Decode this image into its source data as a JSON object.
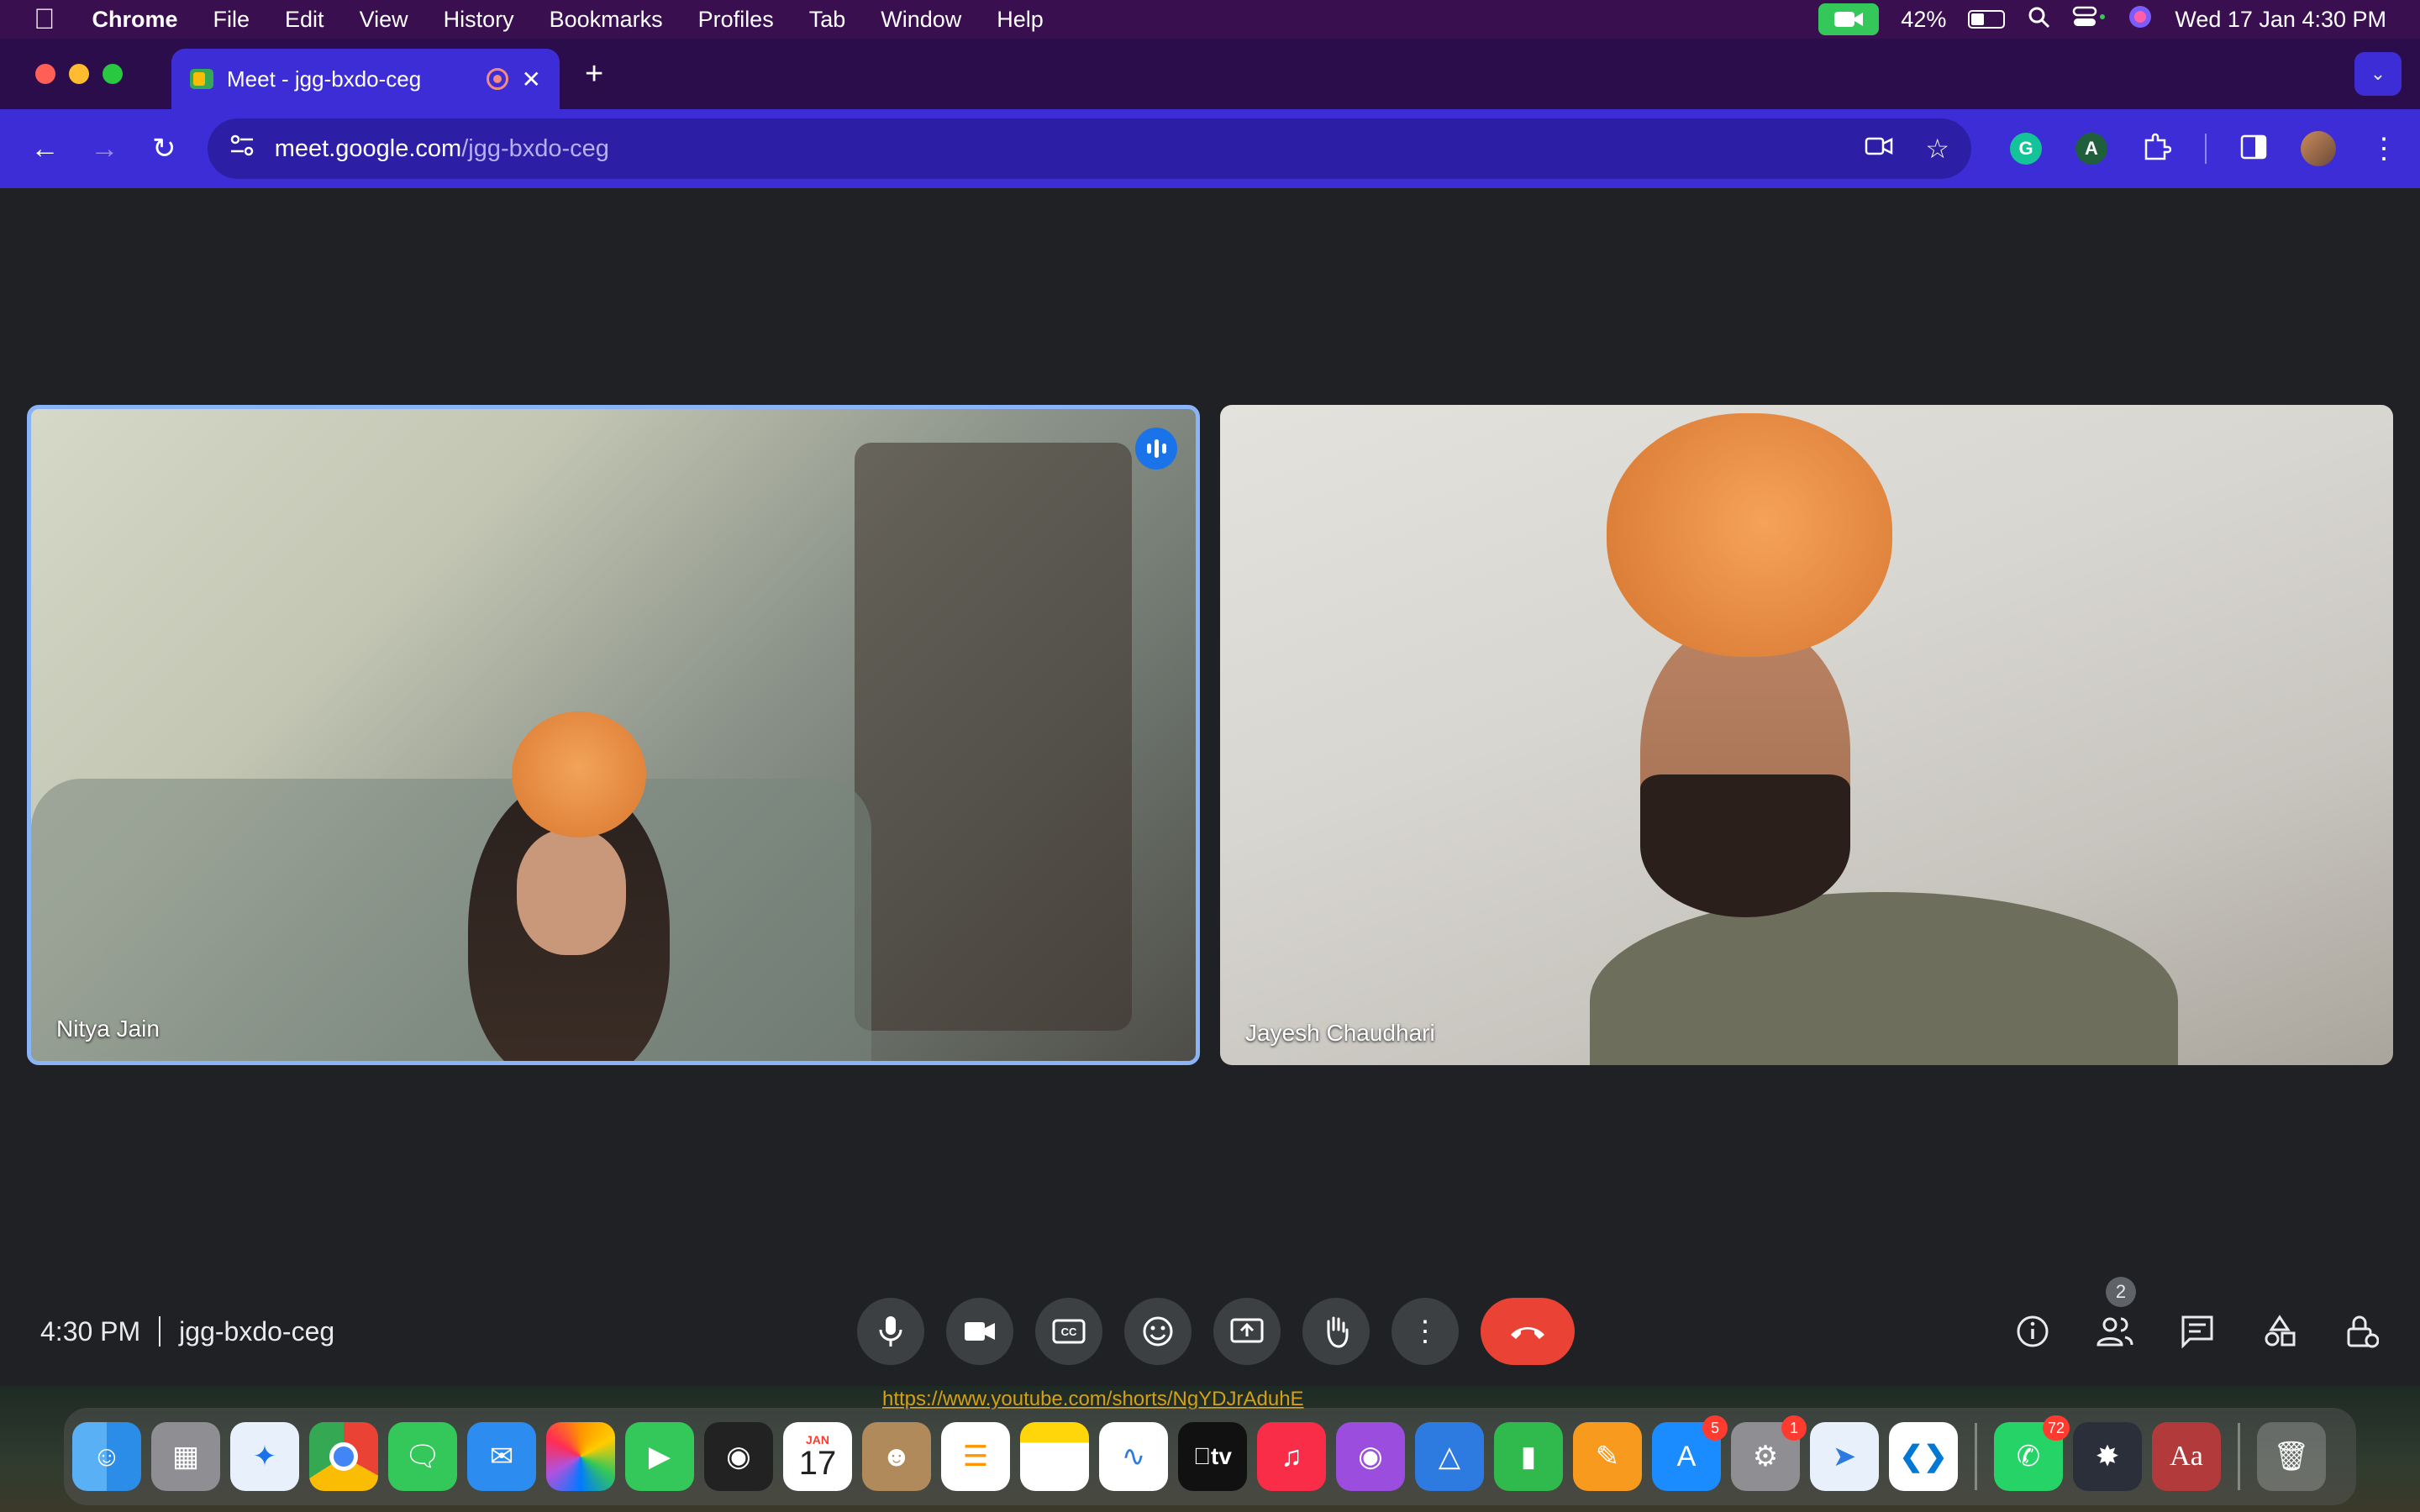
{
  "menubar": {
    "app": "Chrome",
    "items": [
      "File",
      "Edit",
      "View",
      "History",
      "Bookmarks",
      "Profiles",
      "Tab",
      "Window",
      "Help"
    ],
    "battery": "42%",
    "battery_level": 0.42,
    "datetime": "Wed 17 Jan  4:30 PM"
  },
  "browser": {
    "tab_title": "Meet - jgg-bxdo-ceg",
    "url_host": "meet.google.com",
    "url_path": "/jgg-bxdo-ceg"
  },
  "meet": {
    "participants": [
      {
        "name": "Nitya Jain",
        "speaking": true
      },
      {
        "name": "Jayesh Chaudhari",
        "speaking": false
      }
    ],
    "time": "4:30 PM",
    "meeting_code": "jgg-bxdo-ceg",
    "participant_count": "2",
    "controls": [
      "microphone-icon",
      "camera-icon",
      "captions-icon",
      "emoji-icon",
      "present-icon",
      "raise-hand-icon",
      "more-options-icon",
      "end-call-icon"
    ],
    "right_controls": [
      "info-icon",
      "people-icon",
      "chat-icon",
      "activities-icon",
      "host-controls-icon"
    ]
  },
  "backdrop": {
    "link": "https://www.youtube.com/shorts/NgYDJrAduhE"
  },
  "dock": {
    "calendar_month": "JAN",
    "calendar_day": "17",
    "appletv_label": "tv",
    "dictionary_label": "Aa",
    "badges": {
      "appstore": "5",
      "settings": "1",
      "whatsapp": "72"
    }
  },
  "colors": {
    "accent": "#3d2dd6",
    "active_speaker": "#8ab4f8",
    "end_call": "#ea4335"
  }
}
